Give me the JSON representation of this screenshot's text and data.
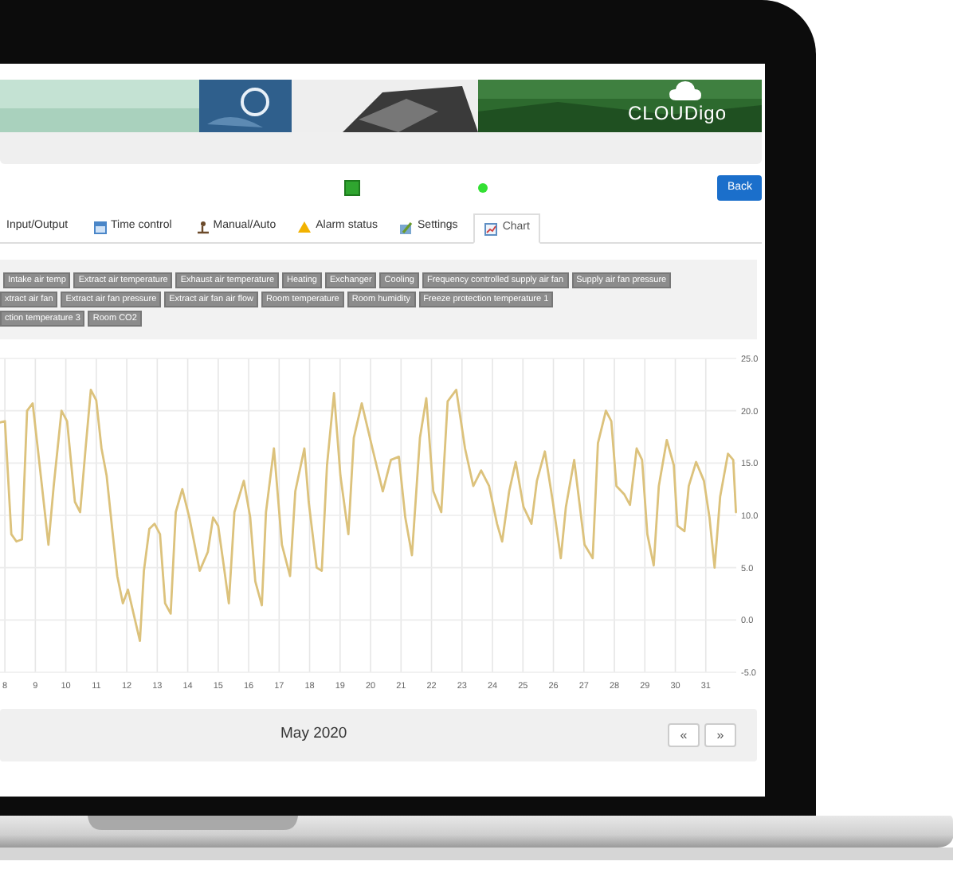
{
  "header": {
    "logo": "CLOUDigo"
  },
  "toolbar": {
    "back_button": "Back"
  },
  "tabs": [
    {
      "label": "Input/Output",
      "selected": false
    },
    {
      "label": "Time control",
      "selected": false
    },
    {
      "label": "Manual/Auto",
      "selected": false
    },
    {
      "label": "Alarm status",
      "selected": false
    },
    {
      "label": "Settings",
      "selected": false
    },
    {
      "label": "Chart",
      "selected": true
    }
  ],
  "tag_rows": [
    [
      "Intake air temp",
      "Extract air temperature",
      "Exhaust air temperature",
      "Heating",
      "Exchanger",
      "Cooling",
      "Frequency controlled supply air fan",
      "Supply air fan pressure"
    ],
    [
      "xtract air fan",
      "Extract air fan pressure",
      "Extract air fan air flow",
      "Room temperature",
      "Room humidity",
      "Freeze protection temperature 1"
    ],
    [
      "ction temperature 3",
      "Room CO2"
    ]
  ],
  "chart": {
    "chart_data": {
      "type": "line",
      "grid": true,
      "xlim": [
        7.84,
        32.0
      ],
      "ylim": [
        -5,
        25
      ],
      "xticks": [
        8,
        9,
        10,
        11,
        12,
        13,
        14,
        15,
        16,
        17,
        18,
        19,
        20,
        21,
        22,
        23,
        24,
        25,
        26,
        27,
        28,
        29,
        30,
        31
      ],
      "yticks": [
        {
          "value": -5,
          "label": "-5.0"
        },
        {
          "value": 0,
          "label": "0.0"
        },
        {
          "value": 5,
          "label": "5.0"
        },
        {
          "value": 10,
          "label": "10.0"
        },
        {
          "value": 15,
          "label": "15.0"
        },
        {
          "value": 20,
          "label": "20.0"
        },
        {
          "value": 25,
          "label": "25.0"
        }
      ],
      "x": [
        7.86,
        8.0,
        8.21,
        8.38,
        8.56,
        8.73,
        8.91,
        9.08,
        9.43,
        9.6,
        9.86,
        10.04,
        10.3,
        10.47,
        10.65,
        10.82,
        11.0,
        11.17,
        11.34,
        11.52,
        11.69,
        11.87,
        12.04,
        12.22,
        12.43,
        12.56,
        12.74,
        12.91,
        13.09,
        13.26,
        13.44,
        13.61,
        13.82,
        14.05,
        14.39,
        14.66,
        14.83,
        15.0,
        15.18,
        15.35,
        15.53,
        15.84,
        16.05,
        16.22,
        16.43,
        16.57,
        16.83,
        17.09,
        17.36,
        17.53,
        17.83,
        17.97,
        18.23,
        18.4,
        18.57,
        18.8,
        19.01,
        19.27,
        19.45,
        19.71,
        20.06,
        20.4,
        20.67,
        20.93,
        21.14,
        21.36,
        21.62,
        21.83,
        22.06,
        22.32,
        22.53,
        22.81,
        23.1,
        23.37,
        23.63,
        23.89,
        24.15,
        24.32,
        24.55,
        24.76,
        25.02,
        25.28,
        25.46,
        25.72,
        25.98,
        26.24,
        26.41,
        26.68,
        26.85,
        27.02,
        27.29,
        27.46,
        27.72,
        27.9,
        28.07,
        28.33,
        28.51,
        28.73,
        28.91,
        29.08,
        29.29,
        29.46,
        29.72,
        29.95,
        30.07,
        30.3,
        30.44,
        30.68,
        30.94,
        31.12,
        31.29,
        31.47,
        31.73,
        31.9,
        31.99
      ],
      "values": [
        18.9,
        19.0,
        8.2,
        7.5,
        7.7,
        20.0,
        20.7,
        16.4,
        7.2,
        12.8,
        20.0,
        19.0,
        11.3,
        10.3,
        16.4,
        22.0,
        21.0,
        16.4,
        13.8,
        8.7,
        4.2,
        1.6,
        2.9,
        0.6,
        -2.0,
        4.7,
        8.7,
        9.2,
        8.2,
        1.6,
        0.6,
        10.3,
        12.5,
        9.8,
        4.7,
        6.5,
        9.8,
        9.0,
        5.2,
        1.6,
        10.3,
        13.3,
        9.8,
        3.7,
        1.4,
        10.3,
        16.4,
        7.2,
        4.2,
        12.3,
        16.4,
        11.3,
        5.0,
        4.7,
        14.8,
        21.7,
        13.8,
        8.2,
        17.4,
        20.7,
        16.4,
        12.3,
        15.3,
        15.6,
        9.8,
        6.2,
        17.4,
        21.2,
        12.3,
        10.3,
        20.9,
        22.0,
        16.4,
        12.8,
        14.3,
        12.8,
        9.2,
        7.5,
        12.3,
        15.1,
        10.8,
        9.2,
        13.3,
        16.1,
        11.3,
        5.9,
        10.8,
        15.3,
        11.3,
        7.2,
        5.9,
        16.9,
        20.0,
        19.0,
        12.8,
        12.0,
        11.0,
        16.4,
        15.3,
        8.2,
        5.2,
        12.8,
        17.2,
        14.8,
        9.0,
        8.5,
        12.8,
        15.1,
        13.3,
        9.8,
        5.0,
        11.8,
        15.9,
        15.3,
        10.3
      ]
    }
  },
  "footer": {
    "period": "May 2020",
    "prev_button": "«",
    "next_button": "»"
  }
}
